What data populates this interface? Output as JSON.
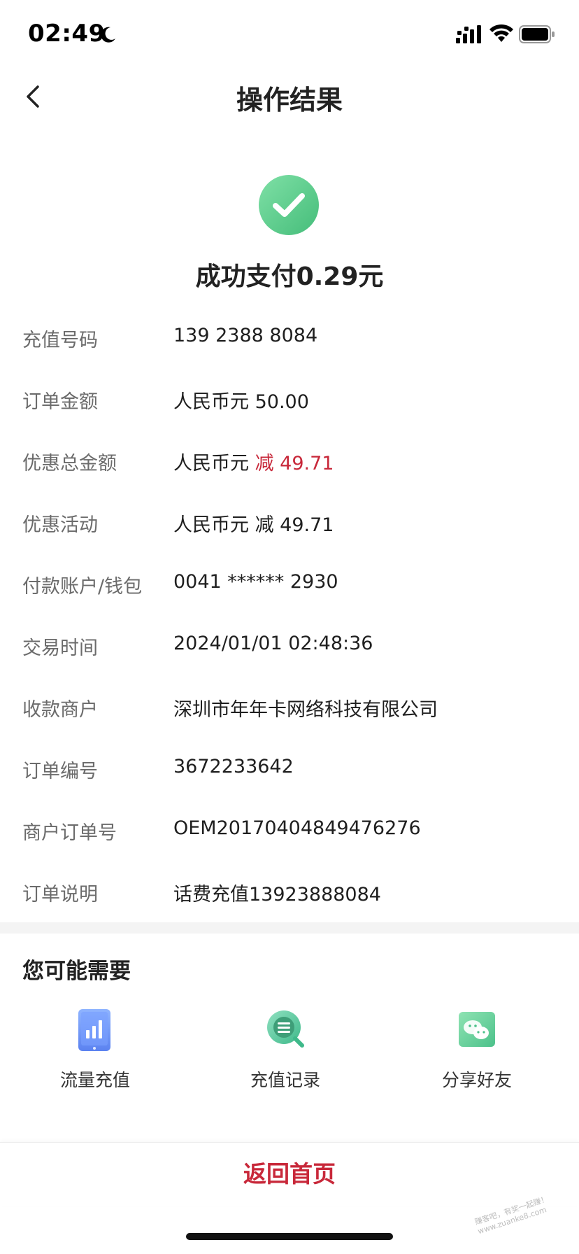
{
  "status_bar": {
    "time": "02:49"
  },
  "header": {
    "title": "操作结果"
  },
  "result": {
    "message": "成功支付0.29元"
  },
  "details": [
    {
      "label": "充值号码",
      "value": "139 2388 8084"
    },
    {
      "label": "订单金额",
      "value": "人民币元 50.00"
    },
    {
      "label": "优惠总金额",
      "value_prefix": "人民币元 ",
      "value_highlight": "减 49.71"
    },
    {
      "label": "优惠活动",
      "value": "人民币元 减 49.71"
    },
    {
      "label": "付款账户/钱包",
      "value": "0041 ****** 2930"
    },
    {
      "label": "交易时间",
      "value": "2024/01/01 02:48:36"
    },
    {
      "label": "收款商户",
      "value": "深圳市年年卡网络科技有限公司"
    },
    {
      "label": "订单编号",
      "value": "3672233642"
    },
    {
      "label": "商户订单号",
      "value": "OEM20170404849476276"
    },
    {
      "label": "订单说明",
      "value": "话费充值13923888084"
    }
  ],
  "suggestions": {
    "title": "您可能需要",
    "items": [
      {
        "label": "流量充值",
        "icon": "data-bars-icon"
      },
      {
        "label": "充值记录",
        "icon": "record-search-icon"
      },
      {
        "label": "分享好友",
        "icon": "wechat-icon"
      }
    ]
  },
  "footer": {
    "home_label": "返回首页"
  },
  "watermark": {
    "line1": "赚客吧，有奖一起赚！",
    "line2": "www.zuanke8.com"
  },
  "colors": {
    "accent_red": "#c8283a",
    "success_green": "#5fcf8f"
  }
}
